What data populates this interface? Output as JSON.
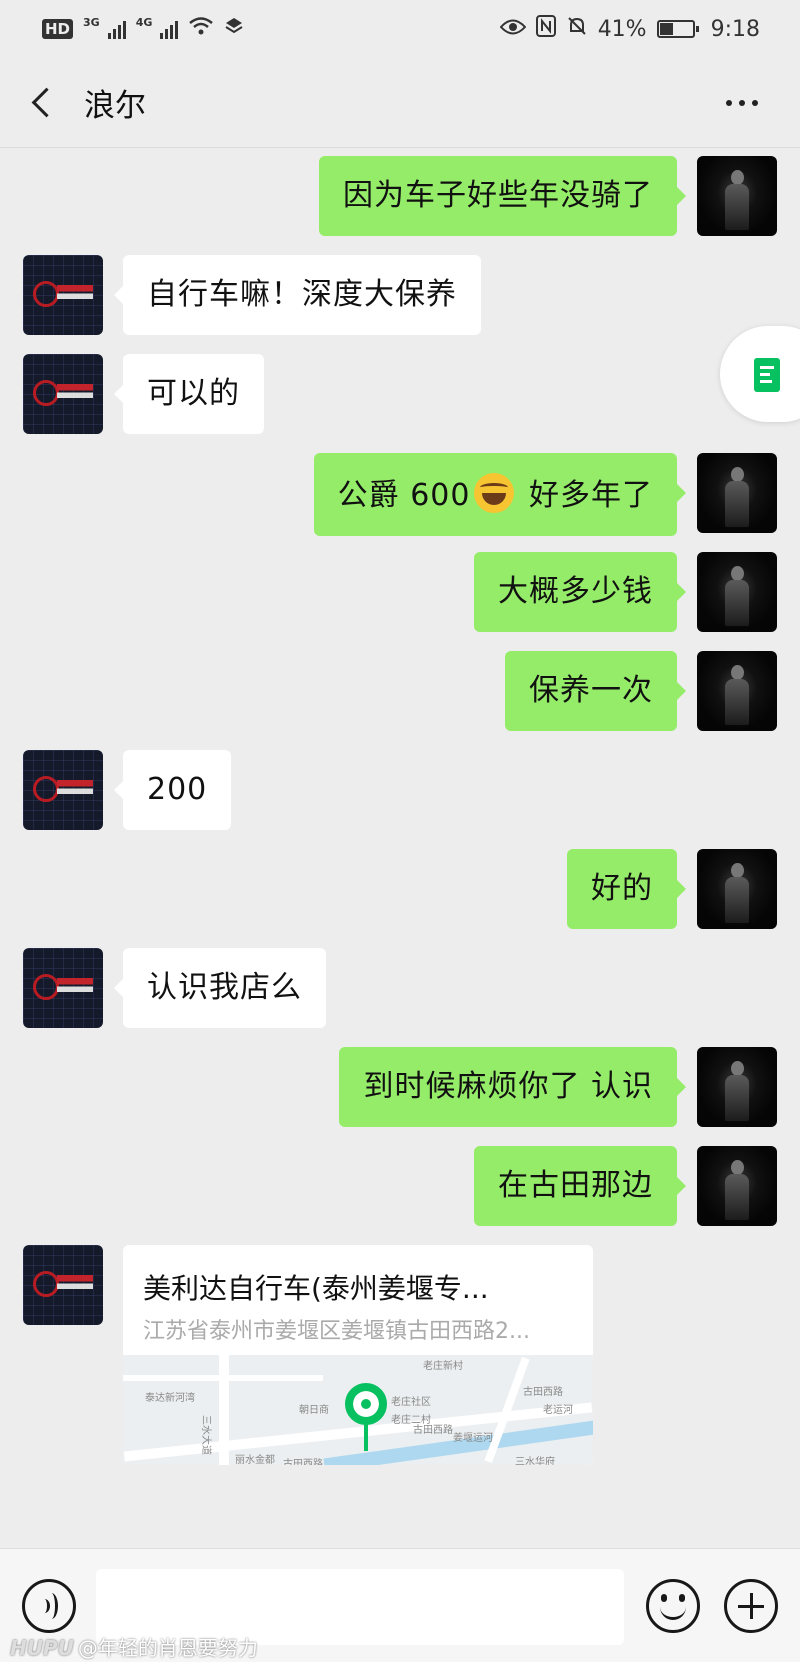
{
  "status_bar": {
    "hd": "HD",
    "network_a": "3G",
    "network_b": "4G",
    "battery_pct": "41%",
    "battery_level": 0.41,
    "time": "9:18"
  },
  "header": {
    "title": "浪尔"
  },
  "messages": [
    {
      "side": "right",
      "text": "因为车子好些年没骑了"
    },
    {
      "side": "left",
      "text": "自行车嘛！深度大保养"
    },
    {
      "side": "left",
      "text": "可以的"
    },
    {
      "side": "right",
      "text_before_emoji": "公爵 600",
      "text_after_emoji": " 好多年了",
      "emoji": "laugh-cry-emoji"
    },
    {
      "side": "right",
      "text": "大概多少钱"
    },
    {
      "side": "right",
      "text": "保养一次"
    },
    {
      "side": "left",
      "text": "200"
    },
    {
      "side": "right",
      "text": "好的"
    },
    {
      "side": "left",
      "text": "认识我店么"
    },
    {
      "side": "right",
      "text": "到时候麻烦你了 认识"
    },
    {
      "side": "right",
      "text": "在古田那边"
    },
    {
      "side": "left",
      "location": {
        "name": "美利达自行车(泰州姜堰专...",
        "address": "江苏省泰州市姜堰区姜堰镇古田西路2...",
        "map_labels": [
          "泰达新河湾",
          "老庄新村",
          "古田西路",
          "老庄社区",
          "老庄二村",
          "朝日商",
          "丽水金都",
          "古田西路",
          "三水大道",
          "三水华府",
          "姜堰运河",
          "老运河",
          "古田西路"
        ]
      }
    }
  ],
  "watermark": {
    "brand": "HUPU",
    "text": "@年轻的肖恩要努力"
  },
  "colors": {
    "sent_bubble": "#95ec69",
    "received_bubble": "#ffffff",
    "background": "#ededed",
    "accent": "#07c160"
  }
}
